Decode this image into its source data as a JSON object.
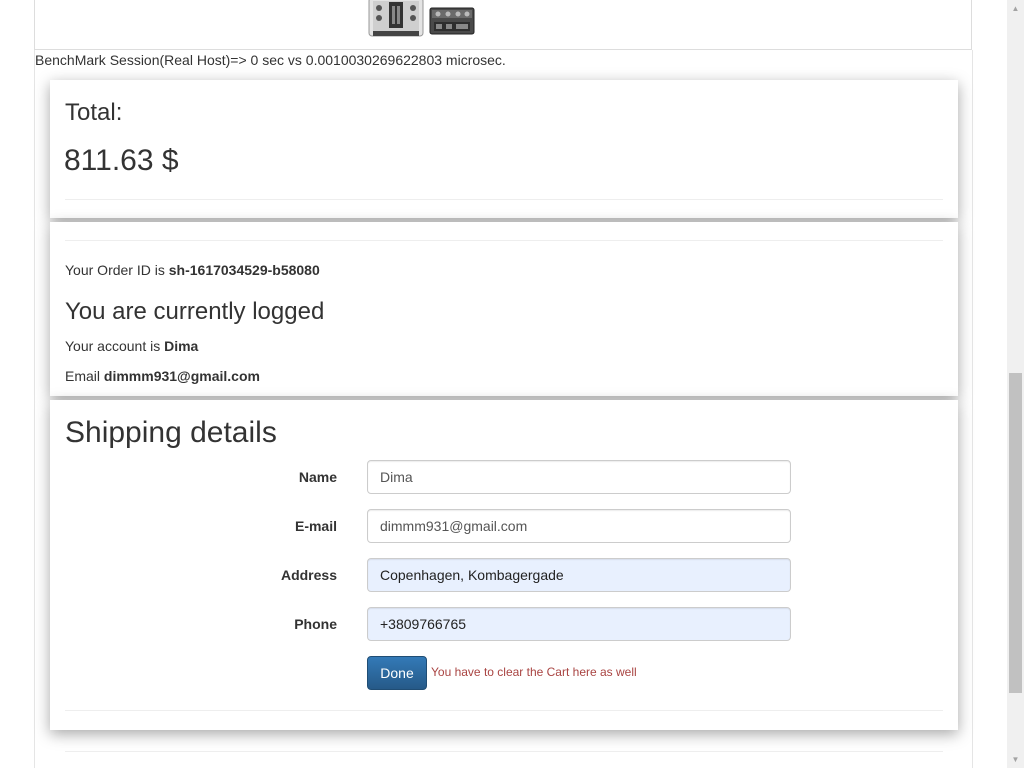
{
  "benchmark": {
    "text": "BenchMark Session(Real Host)=> 0 sec vs 0.0010030269622803 microsec."
  },
  "total": {
    "label": "Total:",
    "amount": "811.63 $"
  },
  "order": {
    "id_prefix": "Your Order ID is ",
    "id_value": "sh-1617034529-b58080",
    "logged_heading": "You are currently logged",
    "account_prefix": "Your account is ",
    "account_value": "Dima",
    "email_prefix": "Email ",
    "email_value": "dimmm931@gmail.com"
  },
  "shipping": {
    "heading": "Shipping details",
    "fields": {
      "name": {
        "label": "Name",
        "value": "Dima"
      },
      "email": {
        "label": "E-mail",
        "value": "dimmm931@gmail.com"
      },
      "address": {
        "label": "Address",
        "value": "Copenhagen, Kombagergade"
      },
      "phone": {
        "label": "Phone",
        "value": "+3809766765"
      }
    },
    "done_label": "Done",
    "clear_note": "You have to clear the Cart here as well"
  },
  "icons": {
    "product_thumb_1": "dj-mixer-thumbnail",
    "product_thumb_2": "audio-interface-thumbnail",
    "scroll_up": "scroll-up-arrow-icon",
    "scroll_down": "scroll-down-arrow-icon"
  },
  "colors": {
    "primary_button": "#337ab7",
    "autofill_background": "#e8f0fe",
    "warning_text": "#a94442"
  }
}
